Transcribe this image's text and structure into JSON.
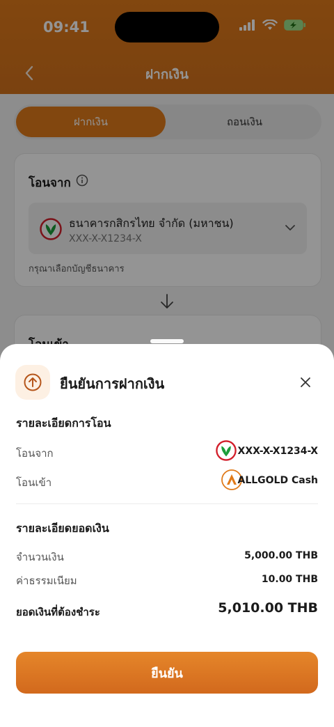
{
  "status_bar": {
    "time": "09:41"
  },
  "nav": {
    "title": "ฝากเงิน"
  },
  "tabs": [
    {
      "label": "ฝากเงิน",
      "active": true
    },
    {
      "label": "ถอนเงิน",
      "active": false
    }
  ],
  "from_card": {
    "title": "โอนจาก",
    "bank_name": "ธนาคารกสิกรไทย จำกัด (มหาชน)",
    "account": "XXX-X-X1234-X",
    "helper": "กรุณาเลือกบัญชีธนาคาร"
  },
  "to_card": {
    "title": "โอนเข้า"
  },
  "sheet": {
    "title": "ยืนยันการฝากเงิน",
    "transfer_section": "รายละเอียดการโอน",
    "from_label": "โอนจาก",
    "from_value": "XXX-X-X1234-X",
    "to_label": "โอนเข้า",
    "to_value": "ALLGOLD Cash",
    "amount_section": "รายละเอียดยอดเงิน",
    "amount_label": "จำนวนเงิน",
    "amount_value": "5,000.00 THB",
    "fee_label": "ค่าธรรมเนียม",
    "fee_value": "10.00 THB",
    "total_label": "ยอดเงินที่ต้องชำระ",
    "total_value": "5,010.00 THB",
    "confirm_label": "ยืนยัน"
  },
  "colors": {
    "brand_orange": "#e07a1a",
    "kbank_green": "#1b9e3a",
    "kbank_red": "#d21f2b"
  }
}
